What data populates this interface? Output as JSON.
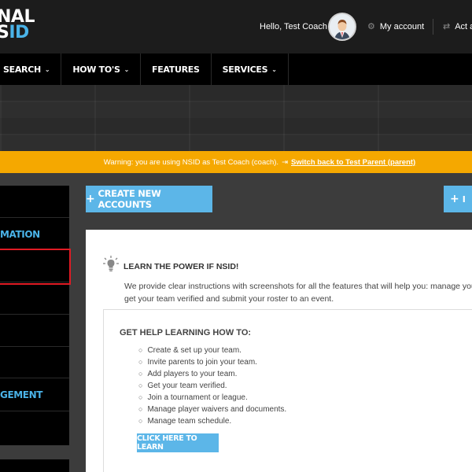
{
  "header": {
    "logo_line1": "NAL",
    "logo_line2_prefix": "S",
    "logo_line2_accent": "ID",
    "greeting": "Hello, Test Coach",
    "my_account": "My account",
    "act_as": "Act a"
  },
  "nav": {
    "items": [
      {
        "label": "SEARCH"
      },
      {
        "label": "HOW TO'S"
      },
      {
        "label": "FEATURES"
      },
      {
        "label": "SERVICES"
      }
    ]
  },
  "warning": {
    "text": "Warning: you are using NSID as Test Coach (coach).",
    "switch_label": "Switch back to Test Parent (parent)"
  },
  "sidebar": {
    "heading1": "MATION",
    "heading2": "GEMENT"
  },
  "toolbar": {
    "create_label": "CREATE NEW ACCOUNTS",
    "right_label": "I"
  },
  "learn": {
    "title": "LEARN THE POWER IF NSID!",
    "desc_line1": "We provide clear instructions with screenshots for all the features that will help you: manage your",
    "desc_line2": "get your team verified and submit your roster to an event."
  },
  "help": {
    "title": "GET HELP LEARNING HOW TO:",
    "items": [
      "Create & set up your team.",
      "Invite parents to join your team.",
      "Add players to your team.",
      "Get your team verified.",
      "Join a tournament or league.",
      "Manage player waivers and documents.",
      "Manage team schedule."
    ],
    "cta_label": "CLICK HERE TO LEARN"
  },
  "colors": {
    "accent": "#4ab3e8",
    "warning": "#f5a800",
    "highlight": "#e01b24"
  }
}
